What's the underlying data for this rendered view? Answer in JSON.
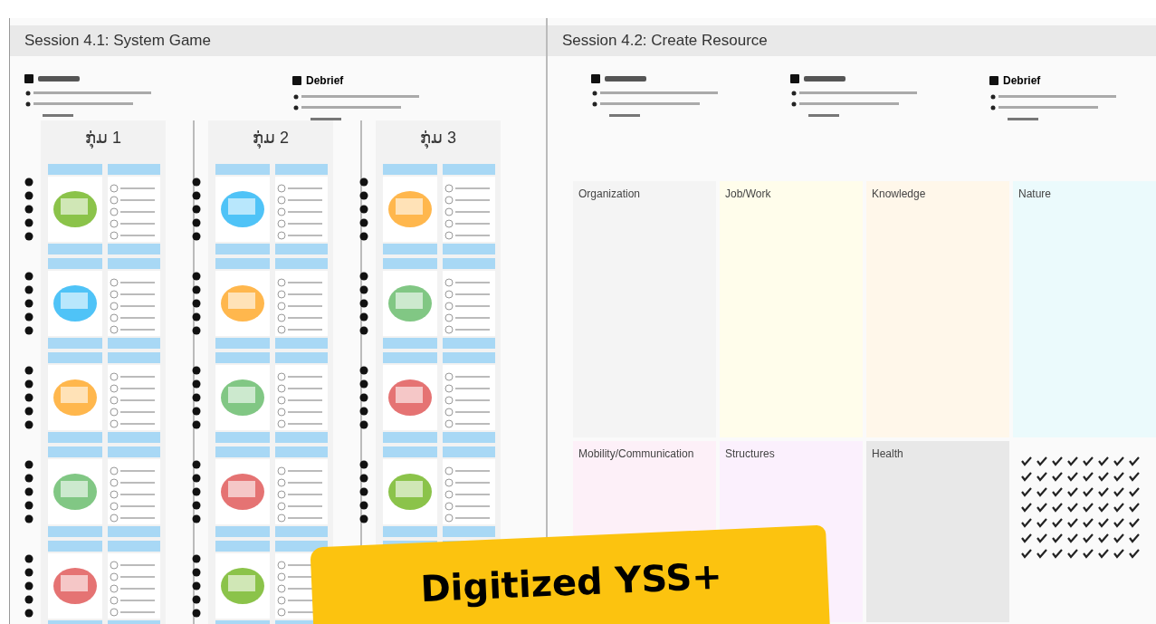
{
  "sessions": [
    {
      "title": "Session 4.1: System Game",
      "steps": [
        {
          "kind": "scribble"
        },
        {
          "kind": "heading",
          "heading": "Debrief"
        }
      ],
      "groups": [
        {
          "title": "ກຸ່ມ 1"
        },
        {
          "title": "ກຸ່ມ 2"
        },
        {
          "title": "ກຸ່ມ 3"
        }
      ]
    },
    {
      "title": "Session 4.2: Create Resource",
      "steps": [
        {
          "kind": "scribble"
        },
        {
          "kind": "scribble"
        },
        {
          "kind": "heading",
          "heading": "Debrief"
        }
      ],
      "categories": [
        {
          "label": "Organization",
          "color": "#f4f4f4"
        },
        {
          "label": "Job/Work",
          "color": "#fffdeb"
        },
        {
          "label": "Knowledge",
          "color": "#fff7ea"
        },
        {
          "label": "Nature",
          "color": "#ebfafc"
        },
        {
          "label": "Mobility/Communication",
          "color": "#fdf0f8"
        },
        {
          "label": "Structures",
          "color": "#fbf0fd"
        },
        {
          "label": "Health",
          "color": "#e8e8e8"
        }
      ]
    }
  ],
  "banner": {
    "text": "Digitized YSS+"
  }
}
